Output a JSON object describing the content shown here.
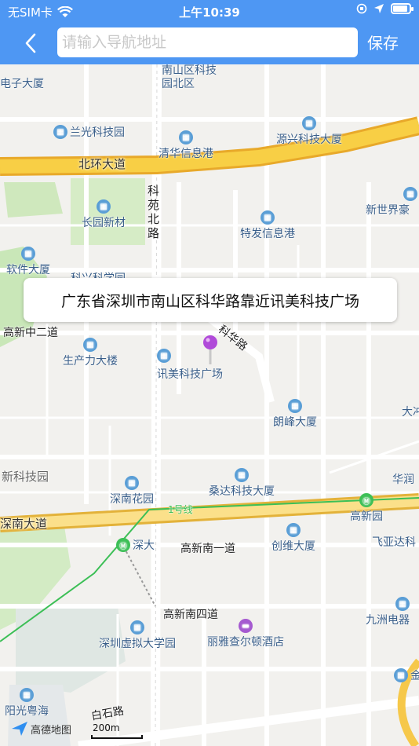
{
  "status_bar": {
    "carrier": "无SIM卡",
    "time": "上午10:39"
  },
  "nav": {
    "search_placeholder": "请输入导航地址",
    "save_label": "保存"
  },
  "colors": {
    "nav_bg": "#4e97f3",
    "highway": "#f6c233",
    "metro_line": "#3cbf56",
    "poi": "#5a9ed6",
    "pin": "#b04ad9"
  },
  "callout": {
    "address": "广东省深圳市南山区科华路靠近讯美科技广场"
  },
  "map": {
    "roads": {
      "beihuan": "北环大道",
      "keyuan": "科苑北路",
      "gaoxin_zhong2": "高新中二道",
      "kehua": "科华路",
      "shennan": "深南大道",
      "gaoxin_nan1": "高新南一道",
      "gaoxin_nan4": "高新南四道",
      "baishi": "白石路",
      "metro_line_1": "1号线"
    },
    "pois": {
      "dianzi": "电子大厦",
      "nanshan_park": "南山区科技园北区",
      "lanquang": "兰光科技园",
      "tsinghua": "清华信息港",
      "yuanxing": "源兴科技大厦",
      "xinshijie": "新世界豪",
      "changyuan": "长园新材",
      "tefa": "特发信息港",
      "ruanjian": "软件大厦",
      "kexing": "科兴科学园",
      "shengchanli": "生产力大楼",
      "xunmei": "讯美科技广场",
      "langfeng": "朗峰大厦",
      "dachong": "大冲",
      "xinkeji": "新科技园",
      "huarun": "华润",
      "shennan_garden": "深南花园",
      "sangda": "桑达科技大厦",
      "gaoxinyuan": "高新园",
      "shenda": "深大",
      "chuangwei": "创维大厦",
      "feiyada": "飞亚达科",
      "jiuzhou": "九洲电器",
      "xuni": "深圳虚拟大学园",
      "ritz": "丽雅查尔顿酒店",
      "jin": "金",
      "yangguang": "阳光粤海"
    },
    "logo": "高德地图",
    "scale": "200m"
  }
}
